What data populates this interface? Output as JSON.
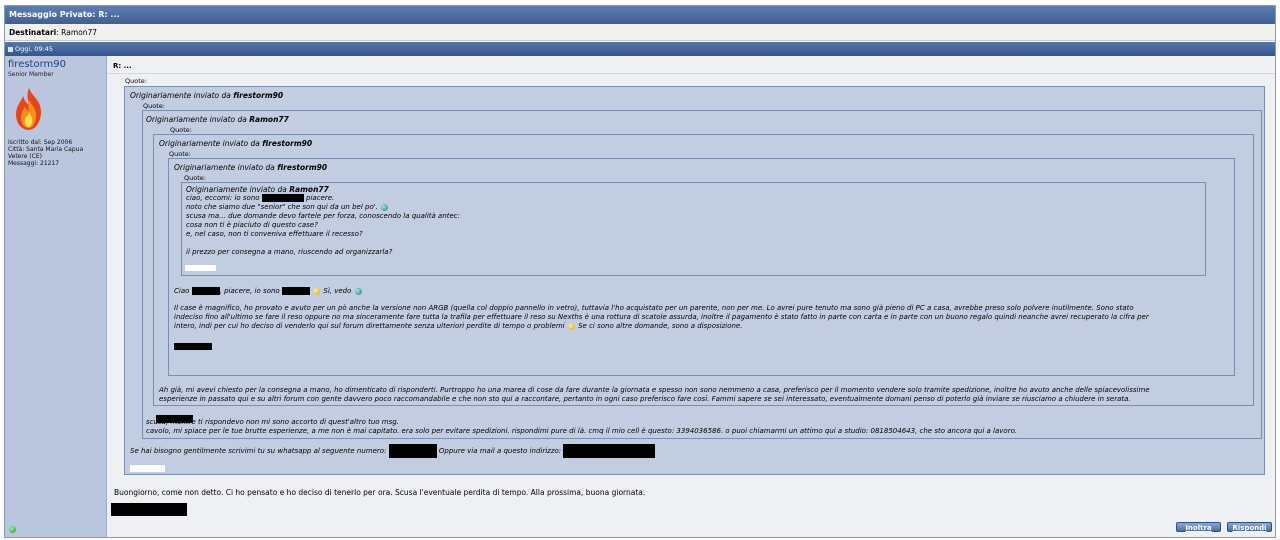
{
  "window": {
    "title": "Messaggio Privato: R: ..."
  },
  "recipients": {
    "label": "Destinatari",
    "value": "Ramon77"
  },
  "post_date": "Oggi, 09:45",
  "user": {
    "name": "firestorm90",
    "rank": "Senior Member",
    "avatar_icon": "flame-icon",
    "info": [
      "Iscritto dal: Sep 2006",
      "Città: Santa Maria Capua",
      "Vetere (CE)",
      "Messaggi: 21217"
    ],
    "online_icon": "online-status-icon"
  },
  "post": {
    "title": "R: ...",
    "quote_label": "Quote:",
    "q1_prefix": "Originariamente inviato da",
    "q1_author": "firestorm90",
    "q2_author": "Ramon77",
    "q3_author": "firestorm90",
    "q4_author": "firestorm90",
    "q5_author": "Ramon77",
    "q5_lines": [
      "ciao, eccomi: io sono",
      "piacere.",
      "noto che siamo due \"senior\" che son qui da un bel po'.",
      "scusa ma... due domande devo fartele per forza, conoscendo la qualità antec:",
      "cosa non ti è piaciuto di questo case?",
      "e, nel caso, non ti conveniva effettuare il recesso?",
      "il prezzo per consegna a mano, riuscendo ad organizzarla?"
    ],
    "q4_ciao": "Ciao",
    "q4_piacere": ", piacere, io sono",
    "q4_si_vedo": "Sì, vedo",
    "q4_paragraph": [
      "Il case è magnifico, ho provato e avuto per un pò anche la versione non ARGB (quella col doppio pannello in vetro), tuttavia l'ho acquistato per un parente, non per me. Lo avrei pure tenuto ma sono già pieno di PC a casa, avrebbe preso solo polvere inutilmente. Sono stato",
      "indeciso fino all'ultimo se fare il reso oppure no ma sinceramente fare tutta la trafila per effettuare il reso su Nexths è una rottura di scatole assurda, inoltre il pagamento è stato fatto in parte con carta e in parte con un buono regalo quindi neanche avrei recuperato la cifra per",
      "intero, indi per cui ho deciso di venderlo qui sul forum direttamente senza ulteriori perdite di tempo o problemi",
      "Se ci sono altre domande, sono a disposizione."
    ],
    "q3_paragraph": [
      "Ah già, mi avevi chiesto per la consegna a mano, ho dimenticato di risponderti. Purtroppo ho una marea di cose da fare durante la giornata e spesso non sono nemmeno a casa, preferisco per il momento vendere solo tramite spedizione, inoltre ho avuto anche delle spiacevolissime",
      "esperienze in passato qui e su altri forum con gente davvero poco raccomandabile e che non sto qui a raccontare, pertanto in ogni caso preferisco fare così. Fammi sapere se sei interessato, eventualmente domani penso di poterlo già inviare se riusciamo a chiudere in serata."
    ],
    "q2_lines": [
      "scusa, mentre ti rispondevo non mi sono accorto di quest'altro tuo msg.",
      "cavolo, mi spiace per le tue brutte esperienze, a me non è mai capitato. era solo per evitare spedizioni. rispondimi pure di là. cmq il mio cell è questo: 3394036586. o puoi chiamarmi un attimo qui a studio: 0818504643, che sto ancora qui a lavoro."
    ],
    "q1_line_a": "Se hai bisogno gentilmente scrivimi tu su whatsapp al seguente numero:",
    "q1_line_b": "Oppure via mail a questo indirizzo:",
    "reply_text": "Buongiorno, come non detto. Ci ho pensato e ho deciso di tenerlo per ora. Scusa l'eventuale perdita di tempo. Alla prossima, buona giornata."
  },
  "buttons": {
    "forward": "Inoltra",
    "reply": "Rispondi"
  }
}
